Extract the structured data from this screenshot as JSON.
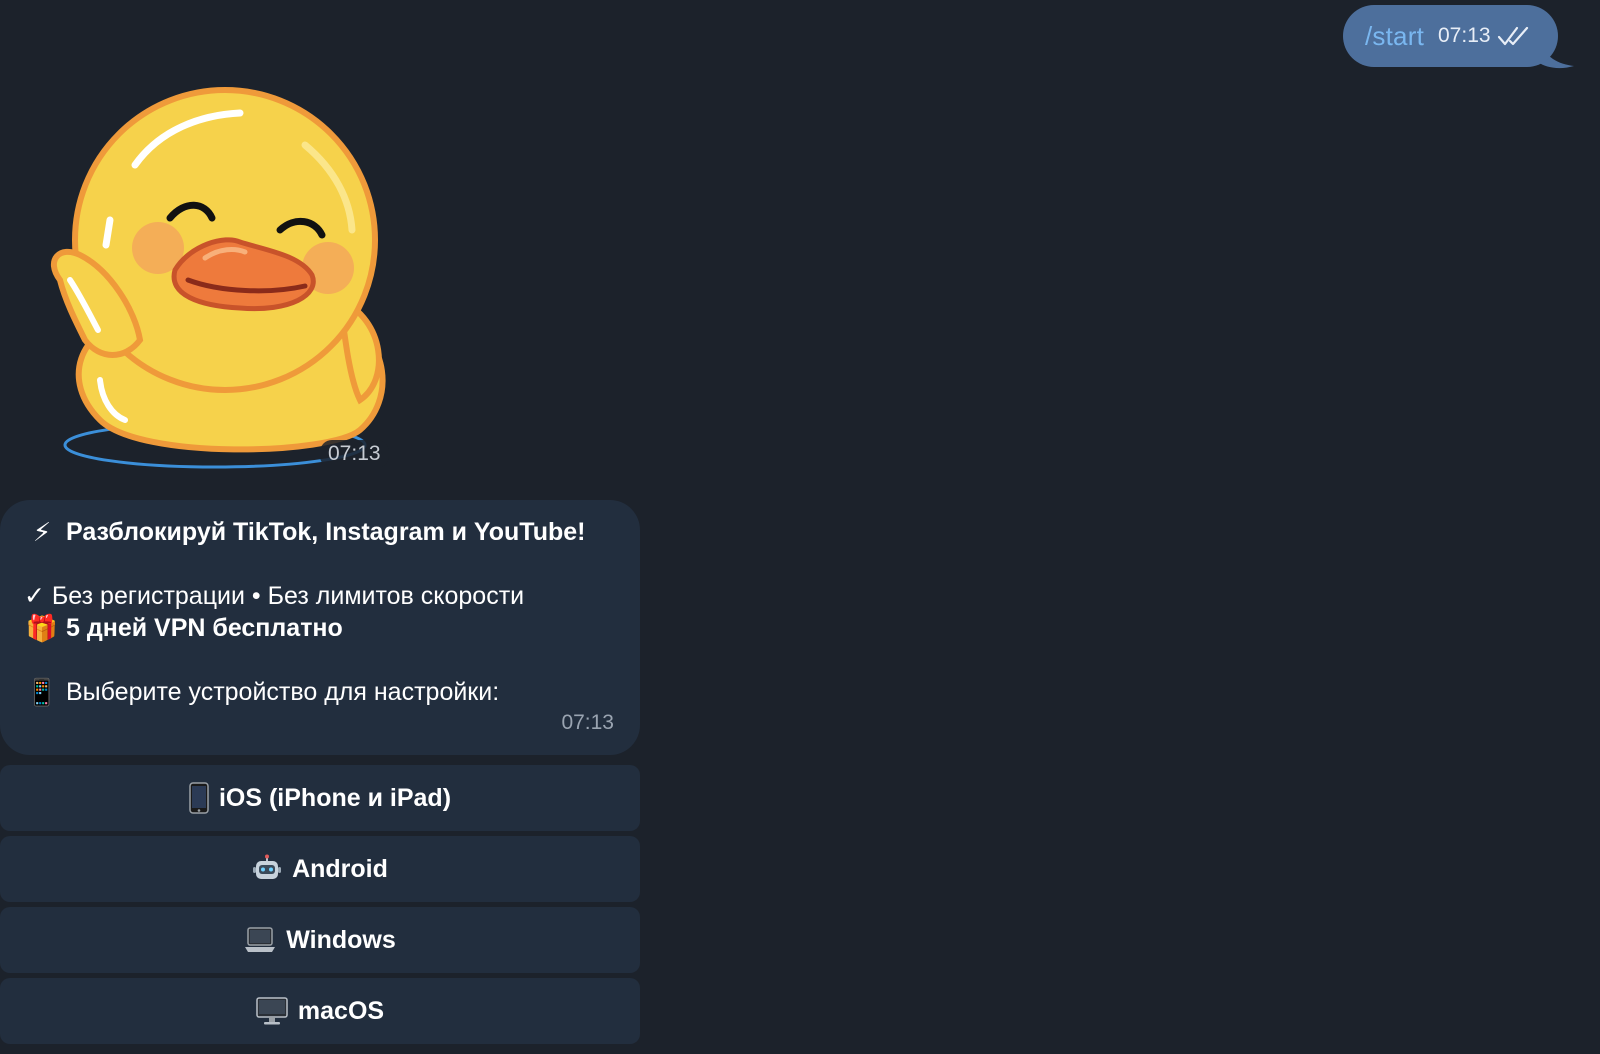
{
  "outgoing": {
    "text": "/start",
    "time": "07:13",
    "status_icon": "double-check-icon"
  },
  "sticker": {
    "icon": "duck-sticker",
    "time": "07:13"
  },
  "message": {
    "headline_emoji": "⚡",
    "headline": "Разблокируй TikTok, Instagram и YouTube!",
    "features": "✓ Без регистрации • Без лимитов скорости",
    "gift_emoji": "🎁",
    "gift": "5 дней VPN бесплатно",
    "prompt_emoji": "📱",
    "prompt": "Выберите устройство для настройки:",
    "time": "07:13"
  },
  "buttons": [
    {
      "icon": "phone-icon",
      "label": "iOS (iPhone и iPad)"
    },
    {
      "icon": "robot-icon",
      "label": "Android"
    },
    {
      "icon": "laptop-icon",
      "label": "Windows"
    },
    {
      "icon": "desktop-icon",
      "label": "macOS"
    }
  ],
  "colors": {
    "background": "#1c222b",
    "outgoing_bubble": "#4d6f9c",
    "incoming_bubble": "#222e3e",
    "command_link": "#7ab7f0"
  }
}
